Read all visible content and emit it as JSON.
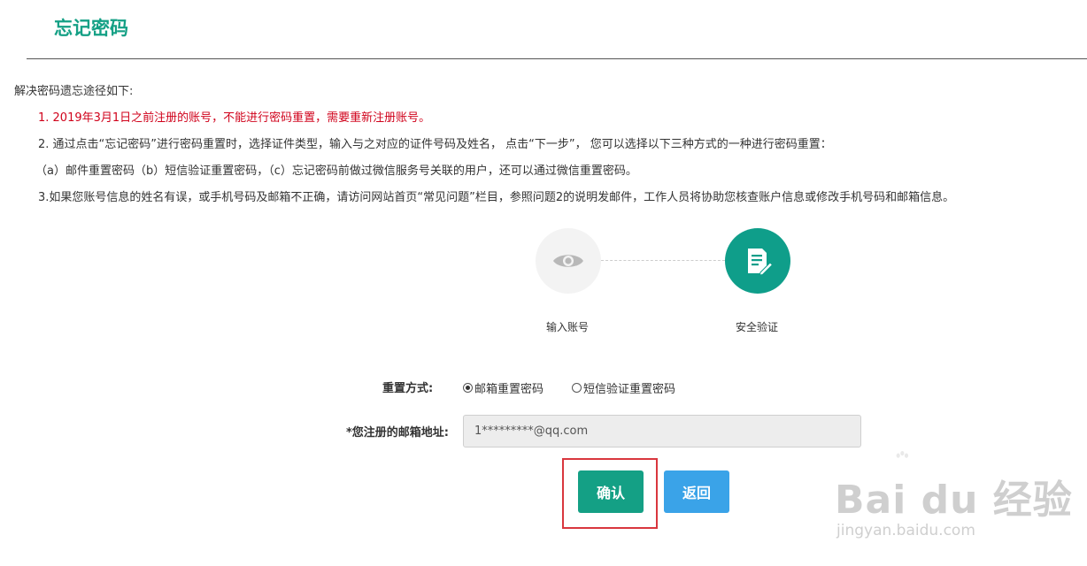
{
  "page": {
    "title": "忘记密码"
  },
  "notes": {
    "intro": "解决密码遗忘途径如下:",
    "item1": "1. 2019年3月1日之前注册的账号，不能进行密码重置，需要重新注册账号。",
    "item2": "2. 通过点击“忘记密码”进行密码重置时，选择证件类型，输入与之对应的证件号码及姓名， 点击“下一步”， 您可以选择以下三种方式的一种进行密码重置：",
    "item2_options": "（a）邮件重置密码（b）短信验证重置密码，（c）忘记密码前做过微信服务号关联的用户，还可以通过微信重置密码。",
    "item3": "3.如果您账号信息的姓名有误，或手机号码及邮箱不正确，请访问网站首页“常见问题”栏目，参照问题2的说明发邮件，工作人员将协助您核查账户信息或修改手机号码和邮箱信息。"
  },
  "steps": [
    {
      "label": "输入账号",
      "icon": "eye-icon",
      "active": false
    },
    {
      "label": "安全验证",
      "icon": "document-edit-icon",
      "active": true
    }
  ],
  "form": {
    "method_label": "重置方式:",
    "method_options": [
      {
        "label": "邮箱重置密码",
        "selected": true
      },
      {
        "label": "短信验证重置密码",
        "selected": false
      }
    ],
    "email_label": "*您注册的邮箱地址:",
    "email_value": "1*********@qq.com"
  },
  "buttons": {
    "confirm": "确认",
    "back": "返回"
  },
  "watermark": {
    "logo_text": "Bai du 经验",
    "url": "jingyan.baidu.com"
  },
  "colors": {
    "brand": "#14a085",
    "warning": "#d0021b",
    "back_button": "#3aa3e8",
    "highlight": "#d9363e"
  }
}
